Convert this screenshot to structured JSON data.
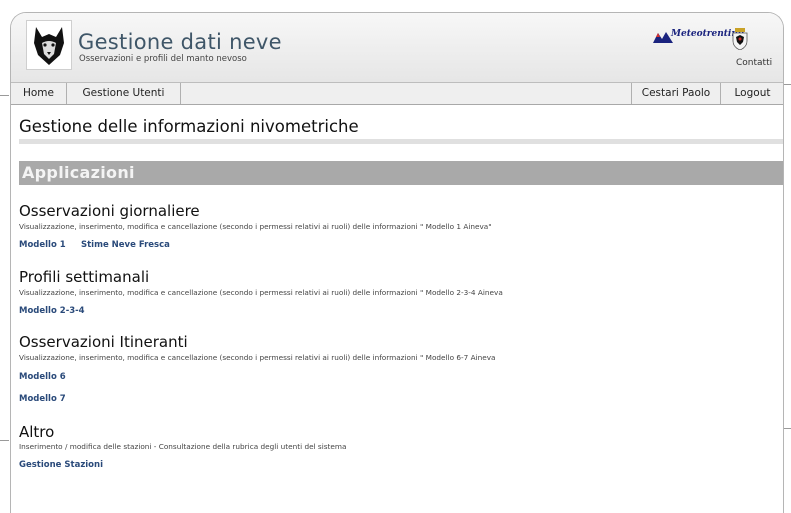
{
  "header": {
    "title": "Gestione dati neve",
    "subtitle": "Osservazioni e profili del manto nevoso",
    "brand": "Meteotrentino",
    "contact_label": "Contatti"
  },
  "nav": {
    "home": "Home",
    "users": "Gestione Utenti",
    "user_name": "Cestari Paolo",
    "logout": "Logout"
  },
  "main": {
    "page_title": "Gestione delle informazioni nivometriche",
    "section_title": "Applicazioni",
    "groups": [
      {
        "title": "Osservazioni giornaliere",
        "description": "Visualizzazione, inserimento, modifica e cancellazione (secondo i permessi relativi ai ruoli) delle informazioni \" Modello 1 Aineva\"",
        "links": [
          "Modello 1",
          "Stime Neve Fresca"
        ]
      },
      {
        "title": "Profili settimanali",
        "description": "Visualizzazione, inserimento, modifica e cancellazione (secondo i permessi relativi ai ruoli) delle informazioni \" Modello 2-3-4 Aineva",
        "links": [
          "Modello 2-3-4"
        ]
      },
      {
        "title": "Osservazioni Itineranti",
        "description": "Visualizzazione, inserimento, modifica e cancellazione (secondo i permessi relativi ai ruoli) delle informazioni \" Modello 6-7 Aineva",
        "links": [
          "Modello 6",
          "Modello 7"
        ]
      },
      {
        "title": "Altro",
        "description": "Inserimento / modifica delle stazioni - Consultazione della rubrica degli utenti del sistema",
        "links": [
          "Gestione Stazioni"
        ]
      }
    ]
  },
  "colors": {
    "header_title": "#3f5668",
    "link": "#2a4a7a",
    "section_bar": "#a9a9a9"
  }
}
